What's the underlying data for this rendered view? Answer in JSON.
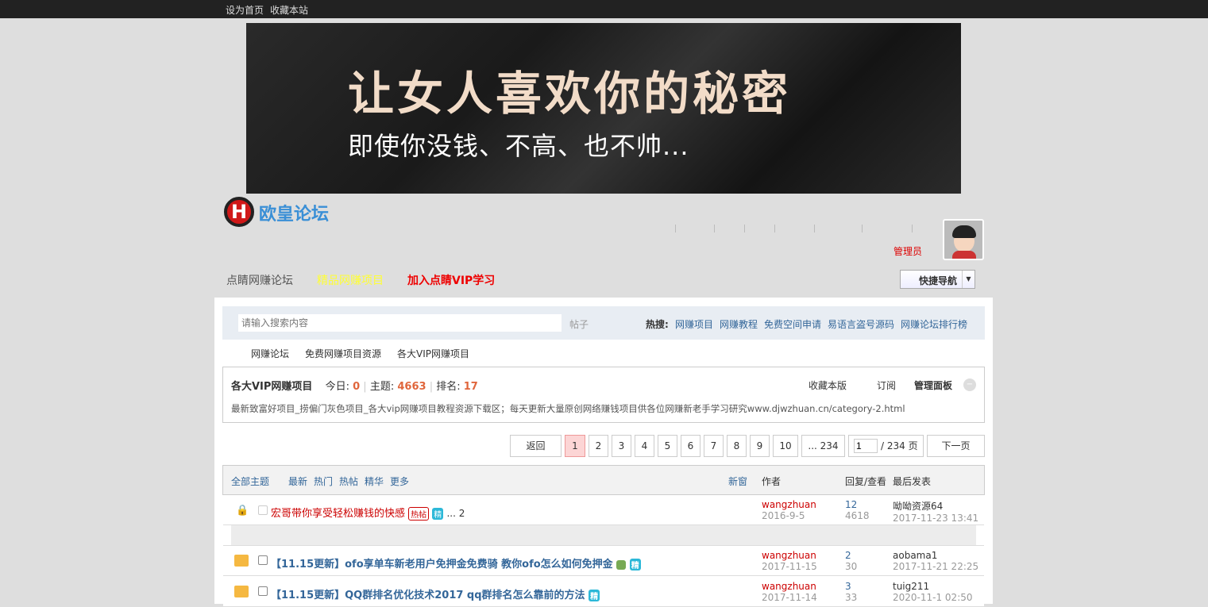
{
  "topbar": {
    "set_home": "设为首页",
    "bookmark": "收藏本站"
  },
  "banner": {
    "headline": "让女人喜欢你的秘密",
    "subline": "即使你没钱、不高、也不帅..."
  },
  "logo": {
    "text": "欧皇论坛",
    "mark": "H"
  },
  "user": {
    "role": "管理员"
  },
  "nav": {
    "items": [
      {
        "label": "点睛网赚论坛",
        "color": "#555"
      },
      {
        "label": "精品网赚项目",
        "color": "#ffff33"
      },
      {
        "label": "加入点睛VIP学习",
        "color": "#e00"
      }
    ],
    "quick_nav": "快捷导航"
  },
  "search": {
    "placeholder": "请输入搜索内容",
    "type": "帖子",
    "hot_label": "热搜:",
    "hot": [
      "网赚项目",
      "网赚教程",
      "免费空间申请",
      "易语言盗号源码",
      "网赚论坛排行榜"
    ]
  },
  "breadcrumb": [
    "网赚论坛",
    "免费网赚项目资源",
    "各大VIP网赚项目"
  ],
  "forum": {
    "name": "各大VIP网赚项目",
    "today_label": "今日:",
    "today": "0",
    "topics_label": "主题:",
    "topics": "4663",
    "rank_label": "排名:",
    "rank": "17",
    "favorite": "收藏本版",
    "subscribe": "订阅",
    "admin_panel": "管理面板",
    "description": "最新致富好项目_捞偏门灰色项目_各大vip网赚项目教程资源下载区；每天更新大量原创网络赚钱项目供各位网赚新老手学习研究www.djwzhuan.cn/category-2.html"
  },
  "pagination": {
    "back": "返回",
    "pages": [
      "1",
      "2",
      "3",
      "4",
      "5",
      "6",
      "7",
      "8",
      "9",
      "10",
      "... 234"
    ],
    "current_input": "1",
    "total": "/ 234 页",
    "next": "下一页"
  },
  "thead": {
    "all": "全部主题",
    "filters": [
      "最新",
      "热门",
      "热帖",
      "精华",
      "更多"
    ],
    "new_window": "新窗",
    "author": "作者",
    "replies_views": "回复/查看",
    "last_post": "最后发表"
  },
  "threads": [
    {
      "title": "宏哥带你享受轻松赚钱的快感",
      "hot_badge": "热帖",
      "digest_badge": "精",
      "pages": "... 2",
      "author": "wangzhuan",
      "date": "2016-9-5",
      "replies": "12",
      "views": "4618",
      "last_user": "呦呦资源64",
      "last_time": "2017-11-23 13:41"
    },
    {
      "title": "【11.15更新】ofo享单车新老用户免押金免费骑 教你ofo怎么如何免押金",
      "digest_badge": "精",
      "author": "wangzhuan",
      "date": "2017-11-15",
      "replies": "2",
      "views": "30",
      "last_user": "aobama1",
      "last_time": "2017-11-21 22:25"
    },
    {
      "title": "【11.15更新】QQ群排名优化技术2017 qq群排名怎么靠前的方法",
      "digest_badge": "精",
      "author": "wangzhuan",
      "date": "2017-11-14",
      "replies": "3",
      "views": "33",
      "last_user": "tuig211",
      "last_time": "2020-11-1 02:50"
    }
  ]
}
